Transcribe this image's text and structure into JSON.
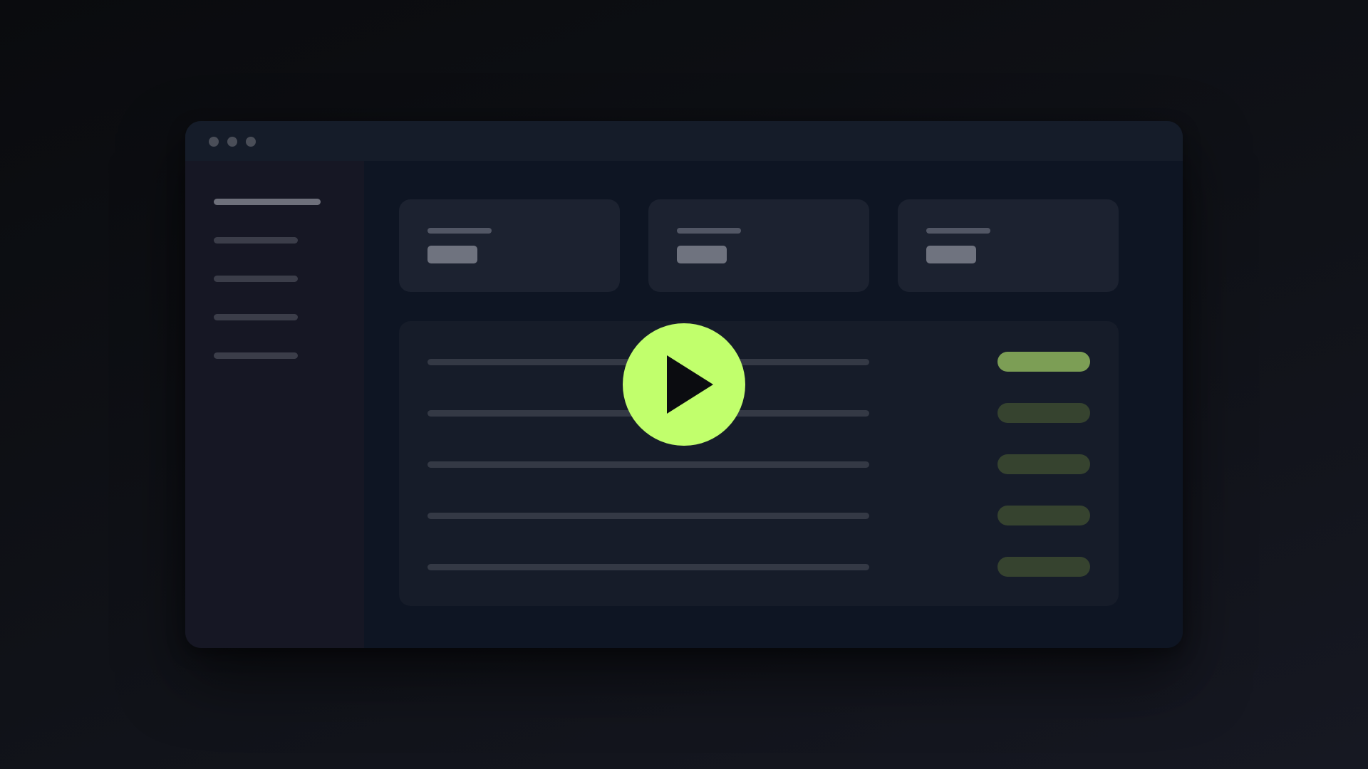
{
  "window": {
    "titlebar": {
      "controls": [
        "window-dot",
        "window-dot",
        "window-dot"
      ],
      "dot_color": "#4a4e58"
    },
    "sidebar": {
      "items": [
        {
          "state": "active"
        },
        {
          "state": "normal"
        },
        {
          "state": "normal"
        },
        {
          "state": "normal"
        },
        {
          "state": "normal"
        }
      ]
    },
    "stat_cards": [
      {
        "label": "",
        "value": ""
      },
      {
        "label": "",
        "value": ""
      },
      {
        "label": "",
        "value": ""
      }
    ],
    "list": {
      "rows": [
        {
          "status": "highlighted"
        },
        {
          "status": "muted"
        },
        {
          "status": "muted"
        },
        {
          "status": "muted"
        },
        {
          "status": "muted"
        }
      ]
    }
  },
  "play_button": {
    "icon": "play-icon",
    "fill_color": "#c1ff6c",
    "icon_color": "#0b0c10"
  },
  "colors": {
    "accent": "#c1ff6c",
    "status_highlight": "#7c9e55",
    "status_muted": "#36432f"
  }
}
